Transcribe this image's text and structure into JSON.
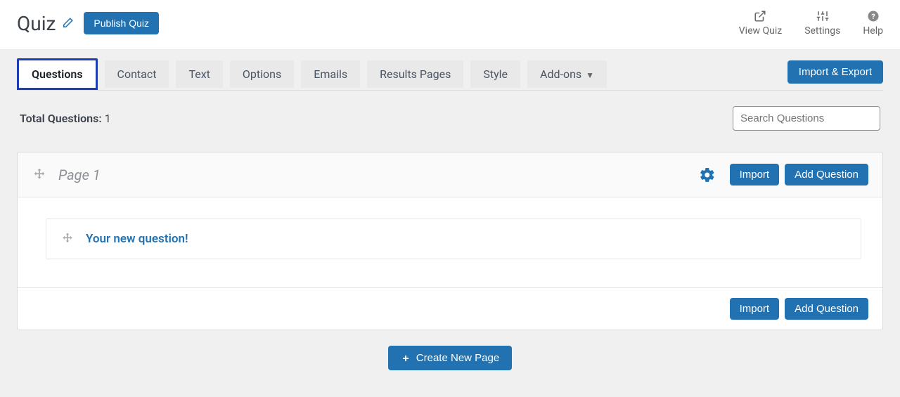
{
  "header": {
    "title": "Quiz",
    "publish_label": "Publish Quiz",
    "tools": [
      {
        "label": "View Quiz"
      },
      {
        "label": "Settings"
      },
      {
        "label": "Help"
      }
    ]
  },
  "tabs": [
    {
      "label": "Questions",
      "active": true
    },
    {
      "label": "Contact"
    },
    {
      "label": "Text"
    },
    {
      "label": "Options"
    },
    {
      "label": "Emails"
    },
    {
      "label": "Results Pages"
    },
    {
      "label": "Style"
    },
    {
      "label": "Add-ons",
      "caret": true
    }
  ],
  "import_export_label": "Import & Export",
  "total_questions": {
    "label": "Total Questions:",
    "count": "1"
  },
  "search_placeholder": "Search Questions",
  "page": {
    "name": "Page 1",
    "import_label": "Import",
    "add_question_label": "Add Question",
    "questions": [
      {
        "title": "Your new question!"
      }
    ]
  },
  "footer": {
    "import_label": "Import",
    "add_question_label": "Add Question"
  },
  "create_page_label": "Create New Page"
}
